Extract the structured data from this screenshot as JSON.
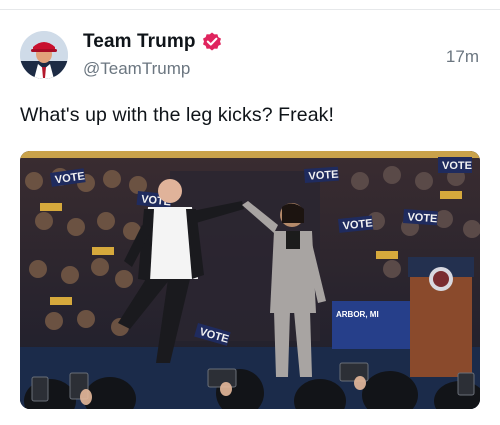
{
  "author": {
    "display_name": "Team Trump",
    "handle": "@TeamTrump",
    "verified_icon": "verified-badge-icon",
    "verified_color": "#e0245e"
  },
  "timestamp": "17m",
  "tweet": {
    "text": "What's up with the leg kicks? Freak!"
  },
  "media": {
    "signs": [
      "VOTE",
      "VOTE",
      "VOTE",
      "VOTE",
      "VOTE",
      "VOTE",
      "VOTE"
    ],
    "banner": "ARBOR, MI"
  }
}
